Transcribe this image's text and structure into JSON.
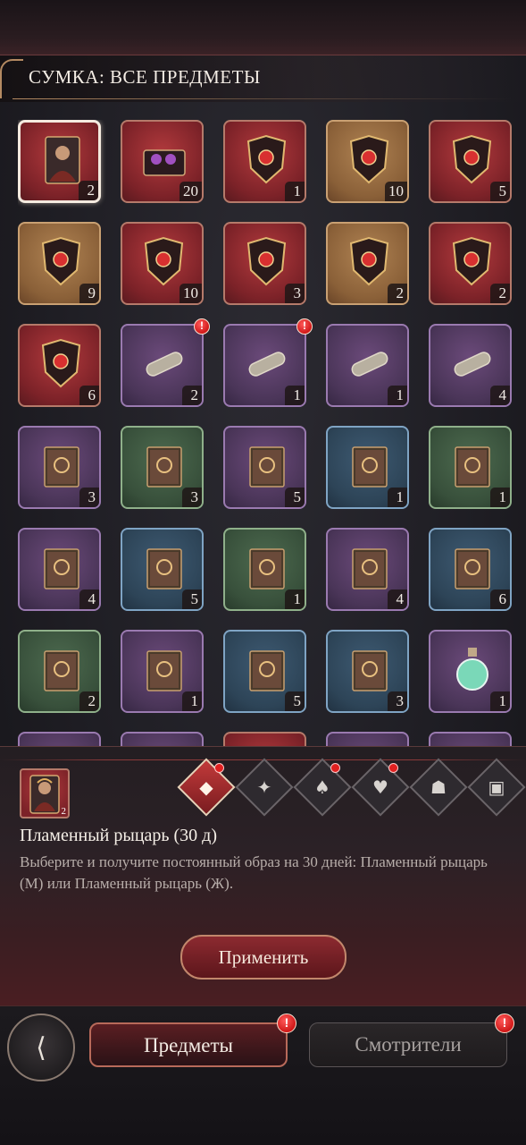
{
  "header": {
    "title": "СУМКА: ВСЕ ПРЕДМЕТЫ"
  },
  "items": [
    {
      "icon": "knight-portrait-icon",
      "count": "2",
      "bg": "red",
      "selected": true,
      "alert": false
    },
    {
      "icon": "gem-chest-icon",
      "count": "20",
      "bg": "red",
      "alert": false
    },
    {
      "icon": "ruby-crest-icon",
      "count": "1",
      "bg": "red",
      "alert": false
    },
    {
      "icon": "crest-badge-icon",
      "count": "10",
      "bg": "gold",
      "alert": false
    },
    {
      "icon": "w-crest-icon",
      "count": "5",
      "bg": "red",
      "alert": false
    },
    {
      "icon": "v-crest-icon",
      "count": "9",
      "bg": "gold",
      "alert": false
    },
    {
      "icon": "sapphire-crest-icon",
      "count": "10",
      "bg": "red",
      "alert": false
    },
    {
      "icon": "tent-emblem-icon",
      "count": "3",
      "bg": "red",
      "alert": false
    },
    {
      "icon": "broken-emblem-icon",
      "count": "2",
      "bg": "gold",
      "alert": false
    },
    {
      "icon": "tower-emblem-icon",
      "count": "2",
      "bg": "red",
      "alert": false
    },
    {
      "icon": "purple-shield-icon",
      "count": "6",
      "bg": "red",
      "alert": false
    },
    {
      "icon": "mystery-scroll-icon",
      "count": "2",
      "bg": "purple",
      "alert": true
    },
    {
      "icon": "silver-scroll-icon",
      "count": "1",
      "bg": "purple",
      "alert": true
    },
    {
      "icon": "blue-scroll-icon",
      "count": "1",
      "bg": "purple",
      "alert": false
    },
    {
      "icon": "gold-scroll-icon",
      "count": "4",
      "bg": "purple",
      "alert": false
    },
    {
      "icon": "mystery-book-stack-icon",
      "count": "3",
      "bg": "purple",
      "alert": false
    },
    {
      "icon": "mystery-book-icon",
      "count": "3",
      "bg": "green",
      "alert": false
    },
    {
      "icon": "fist-book-stack-icon",
      "count": "5",
      "bg": "purple",
      "alert": false
    },
    {
      "icon": "fist-book-icon",
      "count": "1",
      "bg": "blue",
      "alert": false
    },
    {
      "icon": "fist-red-book-icon",
      "count": "1",
      "bg": "green",
      "alert": false
    },
    {
      "icon": "crown-book-stack-icon",
      "count": "4",
      "bg": "purple",
      "alert": false
    },
    {
      "icon": "crown-book-blue-icon",
      "count": "5",
      "bg": "blue",
      "alert": false
    },
    {
      "icon": "crown-book-icon",
      "count": "1",
      "bg": "green",
      "alert": false
    },
    {
      "icon": "lotus-book-stack-icon",
      "count": "4",
      "bg": "purple",
      "alert": false
    },
    {
      "icon": "lotus-book-icon",
      "count": "6",
      "bg": "blue",
      "alert": false
    },
    {
      "icon": "green-book-icon",
      "count": "2",
      "bg": "green",
      "alert": false
    },
    {
      "icon": "eye-book-stack-icon",
      "count": "1",
      "bg": "purple",
      "alert": false
    },
    {
      "icon": "eye-book-blue-icon",
      "count": "5",
      "bg": "blue",
      "alert": false
    },
    {
      "icon": "eye-book-icon",
      "count": "3",
      "bg": "blue",
      "alert": false
    },
    {
      "icon": "potion-flask-icon",
      "count": "1",
      "bg": "purple",
      "alert": false
    },
    {
      "icon": "partial-item-icon",
      "count": "",
      "bg": "purple",
      "alert": false
    },
    {
      "icon": "partial-item-icon",
      "count": "",
      "bg": "purple",
      "alert": false
    },
    {
      "icon": "partial-item-icon",
      "count": "",
      "bg": "red",
      "alert": false
    },
    {
      "icon": "partial-item-icon",
      "count": "",
      "bg": "purple",
      "alert": false
    },
    {
      "icon": "partial-item-icon",
      "count": "",
      "bg": "purple",
      "alert": false
    }
  ],
  "alert_symbol": "!",
  "detail": {
    "thumb_count": "2",
    "name": "Пламенный рыцарь (30 д)",
    "description": "Выберите и получите постоянный образ на 30 дней: Пламенный рыцарь (М) или Пламенный рыцарь (Ж).",
    "apply_label": "Применить",
    "category_tabs": [
      {
        "icon": "all-items-icon",
        "active": true,
        "badge": true
      },
      {
        "icon": "bat-icon",
        "active": false,
        "badge": false
      },
      {
        "icon": "mask-icon",
        "active": false,
        "badge": true
      },
      {
        "icon": "heart-potion-icon",
        "active": false,
        "badge": true
      },
      {
        "icon": "cat-icon",
        "active": false,
        "badge": false
      },
      {
        "icon": "gift-box-icon",
        "active": false,
        "badge": false
      }
    ]
  },
  "bottom_nav": {
    "tabs": [
      {
        "label": "Предметы",
        "active": true,
        "alert": true
      },
      {
        "label": "Смотрители",
        "active": false,
        "alert": true
      }
    ]
  },
  "colors": {
    "accent_red": "#b23a3d",
    "gold_border": "#c9a072",
    "alert_red": "#d01818"
  }
}
